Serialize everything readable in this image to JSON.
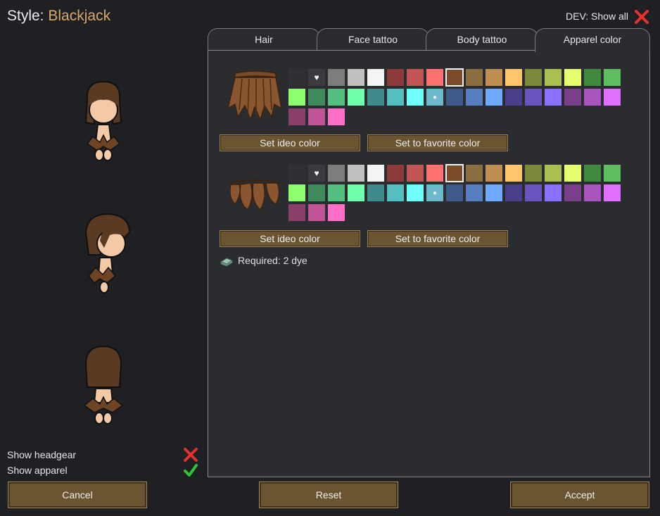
{
  "header": {
    "title_prefix": "Style:",
    "pawn_name": "Blackjack",
    "dev_label": "DEV: Show all",
    "dev_icon": "red-x-icon"
  },
  "tabs": [
    {
      "label": "Hair",
      "active": false
    },
    {
      "label": "Face tattoo",
      "active": false
    },
    {
      "label": "Body tattoo",
      "active": false
    },
    {
      "label": "Apparel color",
      "active": true
    }
  ],
  "palette": {
    "colors": [
      "#2f3033",
      "#3a3b3e",
      "#7d7d7d",
      "#c0c0c0",
      "#f4f4f4",
      "#8c3a3a",
      "#c45555",
      "#ff7070",
      "#7b4a28",
      "#8c6d3f",
      "#bf8f4f",
      "#ffc66e",
      "#7a8a3a",
      "#a9bf50",
      "#e6ff70",
      "#3f8a3f",
      "#5fbf5f",
      "#8cff6e",
      "#3f8a5a",
      "#55bf80",
      "#70ffaa",
      "#3f8a8a",
      "#55bfbf",
      "#70ffff",
      "#6cb8cc",
      "#3f5a8a",
      "#557fbf",
      "#70aaff",
      "#4a3f8a",
      "#6a55bf",
      "#8c70ff",
      "#7a3f8a",
      "#a855bf",
      "#e070ff",
      "#8a3f6a",
      "#bf5595",
      "#ff70c6"
    ],
    "special_icons": {
      "1": "heart-icon",
      "24": "droplet-icon"
    }
  },
  "apparel": [
    {
      "name": "leafy skirt",
      "icon": "leaf-skirt-icon",
      "selected_index": 8,
      "set_ideo_label": "Set ideo color",
      "set_favorite_label": "Set to favorite color"
    },
    {
      "name": "leafy top",
      "icon": "leaf-top-icon",
      "selected_index": 8,
      "set_ideo_label": "Set ideo color",
      "set_favorite_label": "Set to favorite color"
    }
  ],
  "required": {
    "icon": "dye-icon",
    "text": "Required: 2 dye"
  },
  "options": [
    {
      "label": "Show headgear",
      "checked": false,
      "icon": "red-x-icon"
    },
    {
      "label": "Show apparel",
      "checked": true,
      "icon": "green-check-icon"
    }
  ],
  "footer": {
    "cancel": "Cancel",
    "reset": "Reset",
    "accept": "Accept"
  },
  "colors": {
    "accent_name": "#d9a86c",
    "button": "#6b5530",
    "background": "#1e2023",
    "panel": "#2b2c2f"
  }
}
